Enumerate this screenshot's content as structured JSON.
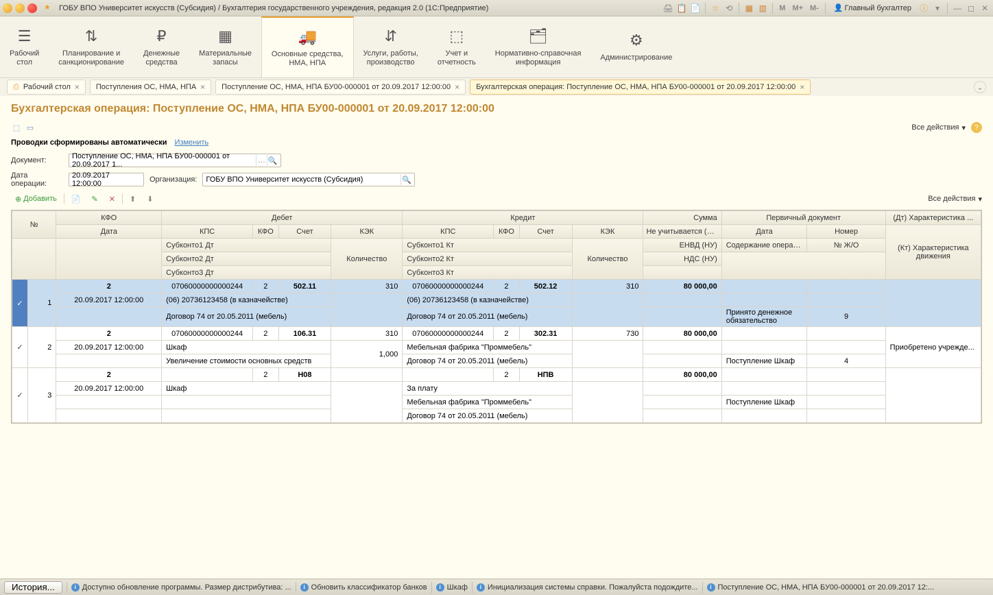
{
  "title": "ГОБУ ВПО Университет искусств (Субсидия) / Бухгалтерия государственного учреждения, редакция 2.0  (1С:Предприятие)",
  "user": "Главный бухгалтер",
  "m_buttons": [
    "M",
    "M+",
    "M-"
  ],
  "nav": [
    {
      "label": "Рабочий\nстол"
    },
    {
      "label": "Планирование и\nсанкционирование"
    },
    {
      "label": "Денежные\nсредства"
    },
    {
      "label": "Материальные\nзапасы"
    },
    {
      "label": "Основные средства,\nНМА, НПА"
    },
    {
      "label": "Услуги, работы,\nпроизводство"
    },
    {
      "label": "Учет и\nотчетность"
    },
    {
      "label": "Нормативно-справочная\nинформация"
    },
    {
      "label": "Администрирование"
    }
  ],
  "tabs": {
    "t0": "Рабочий стол",
    "t1": "Поступления ОС, НМА, НПА",
    "t2": "Поступление ОС, НМА, НПА БУ00-000001 от 20.09.2017 12:00:00",
    "t3": "Бухгалтерская операция: Поступление ОС, НМА, НПА БУ00-000001 от 20.09.2017 12:00:00"
  },
  "page_header": "Бухгалтерская операция: Поступление ОС, НМА, НПА БУ00-000001 от 20.09.2017 12:00:00",
  "all_actions": "Все действия",
  "auto_text": "Проводки сформированы автоматически",
  "change_link": "Изменить",
  "form": {
    "doc_label": "Документ:",
    "doc_value": "Поступление ОС, НМА, НПА БУ00-000001 от 20.09.2017 1...",
    "date_label": "Дата операции:",
    "date_value": "20.09.2017 12:00:00",
    "org_label": "Организация:",
    "org_value": "ГОБУ ВПО Университет искусств (Субсидия)"
  },
  "add_button": "Добавить",
  "headers": {
    "num": "№",
    "kfo": "КФО",
    "debet": "Дебет",
    "kredit": "Кредит",
    "summa": "Сумма",
    "primdoc": "Первичный документ",
    "dtchar": "(Дт) Характеристика ...",
    "date": "Дата",
    "kps": "КПС",
    "kfo2": "КФО",
    "schet": "Счет",
    "kek": "КЭК",
    "neuchit": "Не учитывается (Н...",
    "data2": "Дата",
    "nomer": "Номер",
    "ktchar": "(Кт) Характеристика движения",
    "sub1dt": "Субконто1 Дт",
    "sub2dt": "Субконто2 Дт",
    "sub3dt": "Субконто3 Дт",
    "sub1kt": "Субконто1 Кт",
    "sub2kt": "Субконто2 Кт",
    "sub3kt": "Субконто3 Кт",
    "qty": "Количество",
    "envd": "ЕНВД (НУ)",
    "nds": "НДС (НУ)",
    "soderzh": "Содержание операции",
    "numzho": "№ Ж/О"
  },
  "rows": [
    {
      "n": "1",
      "kfo": "2",
      "date": "20.09.2017 12:00:00",
      "d_kps": "07060000000000244",
      "d_kfo": "2",
      "d_schet": "502.11",
      "d_kek": "310",
      "d_sub1": "(06) 20736123458 (в казначействе)",
      "d_sub2": "Договор 74 от 20.05.2011 (мебель)",
      "k_kps": "07060000000000244",
      "k_kfo": "2",
      "k_schet": "502.12",
      "k_kek": "310",
      "k_sub1": "(06) 20736123458 (в казначействе)",
      "k_sub2": "Договор 74 от 20.05.2011 (мебель)",
      "sum": "80 000,00",
      "soderzh": "Принято денежное обязательство",
      "zho": "9"
    },
    {
      "n": "2",
      "kfo": "2",
      "date": "20.09.2017 12:00:00",
      "d_kps": "07060000000000244",
      "d_kfo": "2",
      "d_schet": "106.31",
      "d_kek": "310",
      "d_qty": "1,000",
      "d_sub1": "Шкаф",
      "d_sub2": "Увеличение стоимости основных средств",
      "k_kps": "07060000000000244",
      "k_kfo": "2",
      "k_schet": "302.31",
      "k_kek": "730",
      "k_sub1": "Мебельная фабрика \"Проммебель\"",
      "k_sub2": "Договор 74 от 20.05.2011 (мебель)",
      "sum": "80 000,00",
      "soderzh": "Поступление Шкаф",
      "zho": "4",
      "ktchar": "Приобретено учрежде..."
    },
    {
      "n": "3",
      "kfo": "2",
      "date": "20.09.2017 12:00:00",
      "d_kfo": "2",
      "d_schet": "Н08",
      "d_sub1": "Шкаф",
      "k_kfo": "2",
      "k_schet": "НПВ",
      "k_sub1": "За плату",
      "k_sub2": "Мебельная фабрика \"Проммебель\"",
      "k_sub3": "Договор 74 от 20.05.2011 (мебель)",
      "sum": "80 000,00",
      "soderzh": "Поступление Шкаф"
    }
  ],
  "status": {
    "history": "История...",
    "s1": "Доступно обновление программы. Размер дистрибутива: ...",
    "s2": "Обновить классификатор банков",
    "s3": "Шкаф",
    "s4": "Инициализация системы справки. Пожалуйста подождите...",
    "s5": "Поступление ОС, НМА, НПА БУ00-000001 от 20.09.2017 12:..."
  }
}
